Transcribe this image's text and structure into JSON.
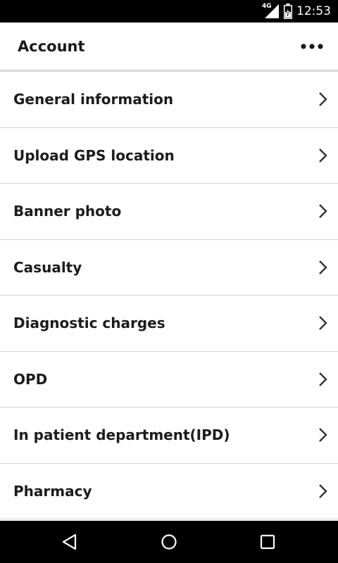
{
  "status_bar": {
    "network": "4G",
    "time": "12:53",
    "icons": [
      "signal-icon",
      "battery-charging-icon"
    ]
  },
  "app_bar": {
    "title": "Account",
    "overflow_icon": "more-horiz-icon"
  },
  "menu": {
    "items": [
      {
        "label": "General information",
        "icon": "chevron-right-icon"
      },
      {
        "label": "Upload GPS location",
        "icon": "chevron-right-icon"
      },
      {
        "label": "Banner photo",
        "icon": "chevron-right-icon"
      },
      {
        "label": "Casualty",
        "icon": "chevron-right-icon"
      },
      {
        "label": "Diagnostic charges",
        "icon": "chevron-right-icon"
      },
      {
        "label": "OPD",
        "icon": "chevron-right-icon"
      },
      {
        "label": "In patient department(IPD)",
        "icon": "chevron-right-icon"
      },
      {
        "label": "Pharmacy",
        "icon": "chevron-right-icon"
      }
    ]
  },
  "nav_bar": {
    "icons": [
      "back-icon",
      "home-icon",
      "recents-icon"
    ]
  },
  "colors": {
    "status_bar_bg": "#000000",
    "nav_bar_bg": "#000000",
    "text": "#1c1c1c",
    "divider": "#d4d4d4",
    "chevron": "#333333"
  }
}
